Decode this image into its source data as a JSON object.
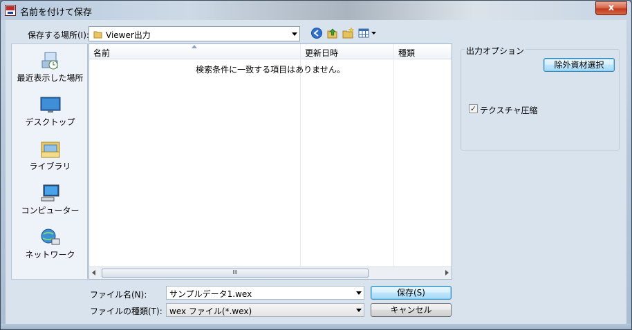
{
  "window": {
    "title": "名前を付けて保存",
    "close_label": "x"
  },
  "location": {
    "label": "保存する場所(I):",
    "value": "Viewer出力"
  },
  "toolbar": {
    "icons": [
      "back-icon",
      "up-folder-icon",
      "new-folder-icon",
      "view-menu-icon"
    ]
  },
  "places": [
    {
      "label": "最近表示した場所",
      "icon": "recent-places-icon"
    },
    {
      "label": "デスクトップ",
      "icon": "desktop-icon"
    },
    {
      "label": "ライブラリ",
      "icon": "libraries-icon"
    },
    {
      "label": "コンピューター",
      "icon": "computer-icon"
    },
    {
      "label": "ネットワーク",
      "icon": "network-icon"
    }
  ],
  "list": {
    "columns": [
      "名前",
      "更新日時",
      "種類"
    ],
    "empty_message": "検索条件に一致する項目はありません。",
    "scroll_thumb": "III"
  },
  "filename": {
    "label": "ファイル名(N):",
    "value": "サンプルデータ1.wex"
  },
  "filetype": {
    "label": "ファイルの種類(T):",
    "value": "wex ファイル(*.wex)"
  },
  "buttons": {
    "save": "保存(S)",
    "cancel": "キャンセル"
  },
  "options": {
    "group_title": "出力オプション",
    "exclude_button": "除外資材選択",
    "texture_compress": {
      "label": "テクスチャ圧縮",
      "checked": true
    }
  },
  "colors": {
    "default_button": "#bee6fd",
    "client_bg": "#d9e3ee"
  }
}
